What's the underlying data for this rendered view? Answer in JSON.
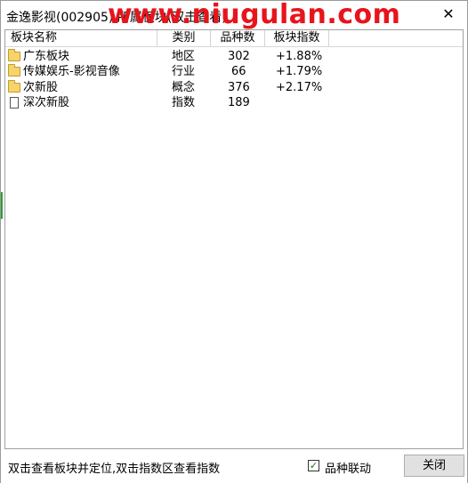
{
  "window": {
    "title": "金逸影视(002905)  所属板块(双击查看)",
    "watermark": "www.niugulan.com",
    "close_glyph": "✕"
  },
  "table": {
    "columns": [
      "板块名称",
      "类别",
      "品种数",
      "板块指数"
    ],
    "rows": [
      {
        "icon": "folder-icon",
        "name": "广东板块",
        "category": "地区",
        "count": "302",
        "index": "+1.88%"
      },
      {
        "icon": "folder-icon",
        "name": "传媒娱乐-影视音像",
        "category": "行业",
        "count": "66",
        "index": "+1.79%"
      },
      {
        "icon": "folder-icon",
        "name": "次新股",
        "category": "概念",
        "count": "376",
        "index": "+2.17%"
      },
      {
        "icon": "page-icon",
        "name": "深次新股",
        "category": "指数",
        "count": "189",
        "index": ""
      }
    ]
  },
  "status": {
    "hint": "双击查看板块并定位,双击指数区查看指数",
    "link_checkbox_label": "品种联动",
    "link_checkbox_checked": true,
    "check_glyph": "✓",
    "close_button": "关闭"
  }
}
